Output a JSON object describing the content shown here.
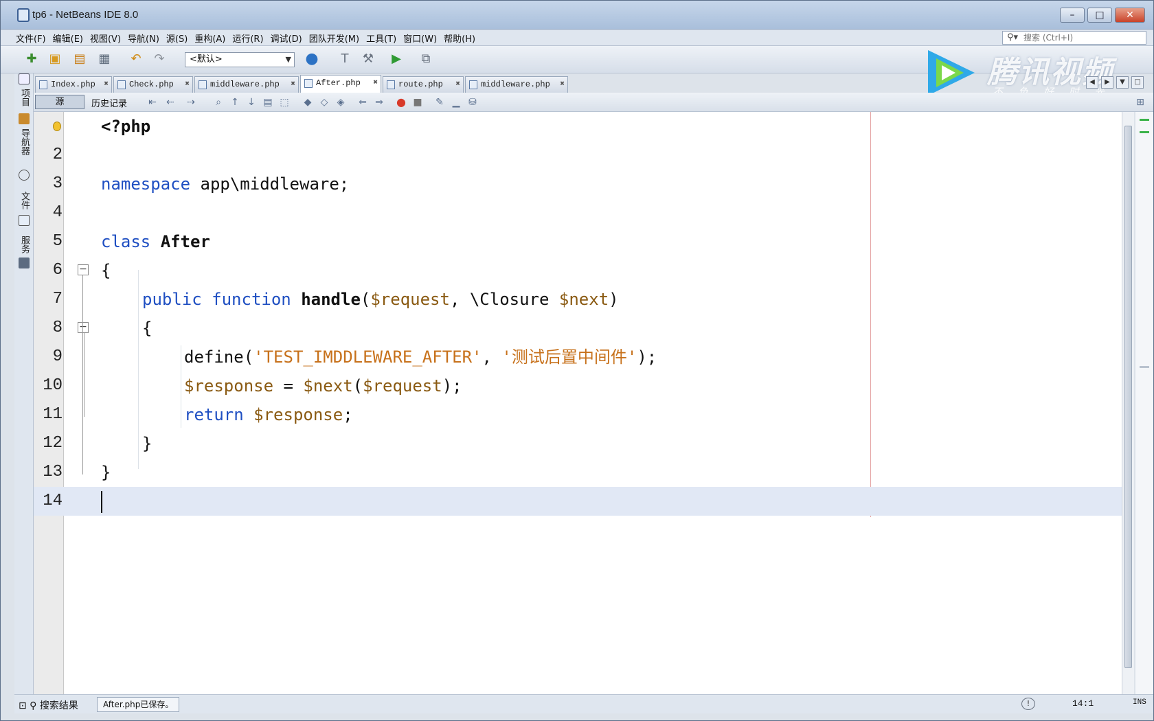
{
  "window": {
    "title": "tp6 - NetBeans IDE 8.0"
  },
  "menu": [
    "文件(F)",
    "编辑(E)",
    "视图(V)",
    "导航(N)",
    "源(S)",
    "重构(A)",
    "运行(R)",
    "调试(D)",
    "团队开发(M)",
    "工具(T)",
    "窗口(W)",
    "帮助(H)"
  ],
  "search": {
    "placeholder": "搜索 (Ctrl+I)"
  },
  "toolbar": {
    "config_value": "<默认>"
  },
  "watermark": {
    "text": "腾讯视频",
    "sub": "不负好时光"
  },
  "side_tabs": [
    "项目",
    "导航器",
    "文件",
    "服务"
  ],
  "tabs": [
    {
      "label": "Index.php",
      "active": false
    },
    {
      "label": "Check.php",
      "active": false
    },
    {
      "label": "middleware.php",
      "active": false
    },
    {
      "label": "After.php",
      "active": true
    },
    {
      "label": "route.php",
      "active": false
    },
    {
      "label": "middleware.php",
      "active": false
    }
  ],
  "editor_toolbar": {
    "source": "源",
    "history": "历史记录"
  },
  "code": {
    "line_numbers": [
      "2",
      "3",
      "4",
      "5",
      "6",
      "7",
      "8",
      "9",
      "10",
      "11",
      "12",
      "13",
      "14"
    ],
    "l1": "<?php",
    "l3_kw": "namespace",
    "l3_rest": " app\\middleware;",
    "l5_kw": "class",
    "l5_name": " After",
    "l6": "{",
    "l7_kw1": "public",
    "l7_kw2": " function",
    "l7_name": " handle",
    "l7_p1": "(",
    "l7_v1": "$request",
    "l7_p2": ", \\Closure ",
    "l7_v2": "$next",
    "l7_p3": ")",
    "l8": "{",
    "l9_fn": "define(",
    "l9_s1": "'TEST_IMDDLEWARE_AFTER'",
    "l9_c": ", ",
    "l9_s2": "'测试后置中间件'",
    "l9_end": ");",
    "l10_v1": "$response",
    "l10_eq": " = ",
    "l10_v2": "$next",
    "l10_p1": "(",
    "l10_v3": "$request",
    "l10_end": ");",
    "l11_kw": "return",
    "l11_sp": " ",
    "l11_v": "$response",
    "l11_end": ";",
    "l12": "}",
    "l13": "}"
  },
  "status": {
    "search_results": "搜索结果",
    "message": "After.php已保存。",
    "position": "14:1",
    "mode": "INS"
  }
}
